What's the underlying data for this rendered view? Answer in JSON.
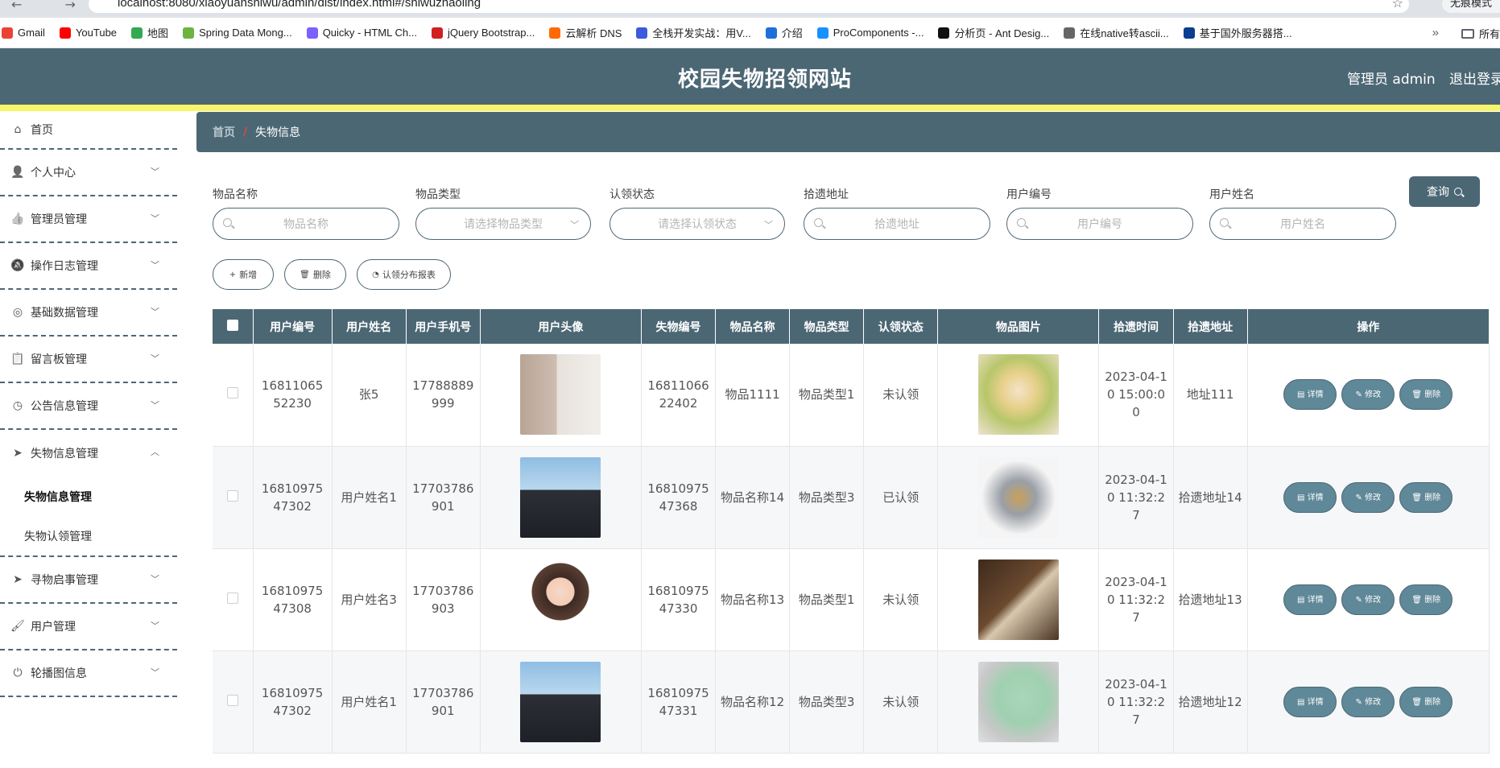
{
  "browser": {
    "url": "localhost:8080/xiaoyuanshiwu/admin/dist/index.html#/shiwuzhaoling",
    "profile_label": "无痕模式",
    "bookmarks": [
      {
        "label": "Gmail",
        "color": "#ea4335"
      },
      {
        "label": "YouTube",
        "color": "#ff0000"
      },
      {
        "label": "地图",
        "color": "#34a853"
      },
      {
        "label": "Spring Data Mong...",
        "color": "#6db33f"
      },
      {
        "label": "Quicky - HTML Ch...",
        "color": "#7b61ff"
      },
      {
        "label": "jQuery Bootstrap...",
        "color": "#d02020"
      },
      {
        "label": "云解析 DNS",
        "color": "#ff6a00"
      },
      {
        "label": "全栈开发实战：用V...",
        "color": "#3b5bdb"
      },
      {
        "label": "介绍",
        "color": "#1e6fd9"
      },
      {
        "label": "ProComponents -...",
        "color": "#1890ff"
      },
      {
        "label": "分析页 - Ant Desig...",
        "color": "#111111"
      },
      {
        "label": "在线native转ascii...",
        "color": "#666666"
      },
      {
        "label": "基于国外服务器搭...",
        "color": "#0b3d91"
      }
    ],
    "bookmarks_folder": "所有"
  },
  "header": {
    "title": "校园失物招领网站",
    "admin_label": "管理员 admin",
    "logout_label": "退出登录"
  },
  "sidebar": {
    "home": "首页",
    "items": [
      {
        "label": "个人中心",
        "icon": "user-icon"
      },
      {
        "label": "管理员管理",
        "icon": "thumb-icon"
      },
      {
        "label": "操作日志管理",
        "icon": "bell-off-icon"
      },
      {
        "label": "基础数据管理",
        "icon": "target-icon"
      },
      {
        "label": "留言板管理",
        "icon": "clipboard-icon"
      },
      {
        "label": "公告信息管理",
        "icon": "clock-icon"
      }
    ],
    "open_group": {
      "label": "失物信息管理",
      "sub": [
        "失物信息管理",
        "失物认领管理"
      ]
    },
    "items_after": [
      {
        "label": "寻物启事管理",
        "icon": "send-icon"
      },
      {
        "label": "用户管理",
        "icon": "brush-icon"
      },
      {
        "label": "轮播图信息",
        "icon": "power-icon"
      }
    ]
  },
  "breadcrumb": {
    "home": "首页",
    "separator": "/",
    "current": "失物信息"
  },
  "filters": [
    {
      "label": "物品名称",
      "placeholder": "物品名称",
      "type": "input"
    },
    {
      "label": "物品类型",
      "placeholder": "请选择物品类型",
      "type": "select"
    },
    {
      "label": "认领状态",
      "placeholder": "请选择认领状态",
      "type": "select"
    },
    {
      "label": "拾遗地址",
      "placeholder": "拾遗地址",
      "type": "input"
    },
    {
      "label": "用户编号",
      "placeholder": "用户编号",
      "type": "input"
    },
    {
      "label": "用户姓名",
      "placeholder": "用户姓名",
      "type": "input"
    }
  ],
  "query_label": "查询",
  "actions": {
    "add": "新增",
    "delete": "删除",
    "report": "认领分布报表"
  },
  "table": {
    "columns": [
      "用户编号",
      "用户姓名",
      "用户手机号",
      "用户头像",
      "失物编号",
      "物品名称",
      "物品类型",
      "认领状态",
      "物品图片",
      "拾遗时间",
      "拾遗地址",
      "操作"
    ],
    "op_labels": {
      "detail": "详情",
      "edit": "修改",
      "delete": "删除"
    },
    "rows": [
      {
        "user_no": "1681106552230",
        "user_name": "张5",
        "phone": "17788889999",
        "item_no": "1681106622402",
        "item_name": "物品1111",
        "item_type": "物品类型1",
        "status": "未认领",
        "time": "2023-04-10 15:00:00",
        "address": "地址111"
      },
      {
        "user_no": "1681097547302",
        "user_name": "用户姓名1",
        "phone": "17703786901",
        "item_no": "1681097547368",
        "item_name": "物品名称14",
        "item_type": "物品类型3",
        "status": "已认领",
        "time": "2023-04-10 11:32:27",
        "address": "拾遗地址14"
      },
      {
        "user_no": "1681097547308",
        "user_name": "用户姓名3",
        "phone": "17703786903",
        "item_no": "1681097547330",
        "item_name": "物品名称13",
        "item_type": "物品类型1",
        "status": "未认领",
        "time": "2023-04-10 11:32:27",
        "address": "拾遗地址13"
      },
      {
        "user_no": "1681097547302",
        "user_name": "用户姓名1",
        "phone": "17703786901",
        "item_no": "1681097547331",
        "item_name": "物品名称12",
        "item_type": "物品类型3",
        "status": "未认领",
        "time": "2023-04-10 11:32:27",
        "address": "拾遗地址12"
      }
    ]
  }
}
